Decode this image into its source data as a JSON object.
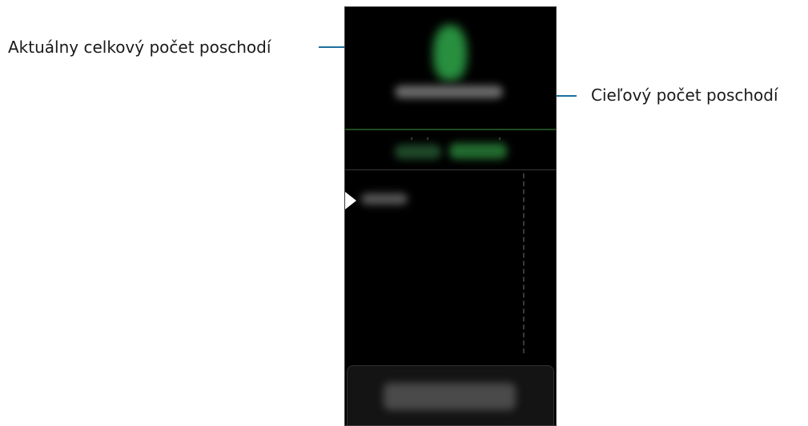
{
  "callouts": {
    "current_total_floors": "Aktuálny celkový počet poschodí",
    "target_floors": "Cieľový počet poschodí"
  },
  "colors": {
    "leader_line": "#1c6f9d",
    "device_background": "#000000",
    "accent_green": "#2fa84a"
  },
  "icons": {
    "runner": "runner-icon",
    "marker": "play-marker-icon"
  }
}
